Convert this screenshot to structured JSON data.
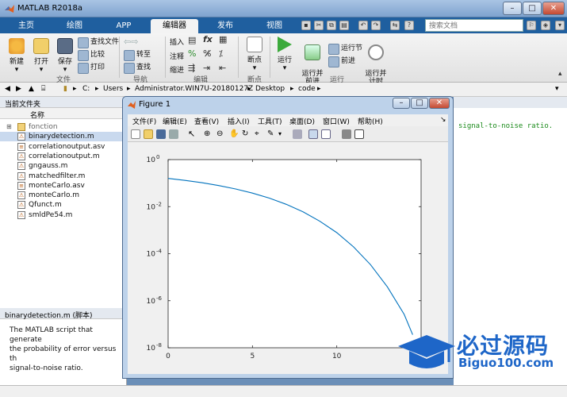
{
  "window": {
    "title": "MATLAB R2018a"
  },
  "ribbon_tabs": [
    "主页",
    "绘图",
    "APP",
    "编辑器",
    "发布",
    "视图"
  ],
  "search": {
    "placeholder": "搜索文档"
  },
  "ribbon": {
    "file": {
      "new": "新建",
      "open": "打开",
      "save": "保存",
      "find_files": "查找文件",
      "compare": "比较",
      "print": "打印",
      "group": "文件"
    },
    "nav": {
      "goto": "转至",
      "find": "查找",
      "group": "导航"
    },
    "edit": {
      "insert": "插入",
      "comment": "注释",
      "indent": "缩进",
      "fx": "fx",
      "group": "编辑"
    },
    "breakpoints": {
      "label": "断点",
      "group": "断点"
    },
    "run": {
      "run": "运行",
      "run_advance": "运行并\n前进",
      "run_section": "运行节",
      "advance": "前进",
      "run_time": "运行并\n计时",
      "group": "运行"
    }
  },
  "address": {
    "segments": [
      "C:",
      "Users",
      "Administrator.WIN7U-20180127Z",
      "Desktop",
      "code"
    ]
  },
  "file_browser": {
    "header": "当前文件夹",
    "column": "名称",
    "items": [
      {
        "name": "fonction",
        "type": "folder"
      },
      {
        "name": "binarydetection.m",
        "type": "m",
        "selected": true
      },
      {
        "name": "correlationoutput.asv",
        "type": "asv"
      },
      {
        "name": "correlationoutput.m",
        "type": "m"
      },
      {
        "name": "gngauss.m",
        "type": "m"
      },
      {
        "name": "matchedfilter.m",
        "type": "m"
      },
      {
        "name": "monteCarlo.asv",
        "type": "asv"
      },
      {
        "name": "monteCarlo.m",
        "type": "m"
      },
      {
        "name": "Qfunct.m",
        "type": "m"
      },
      {
        "name": "smldPe54.m",
        "type": "m"
      }
    ]
  },
  "details": {
    "header": "binarydetection.m  (脚本)",
    "description_lines": [
      "The MATLAB script that generate",
      "the probability of error versus th",
      "signal-to-noise ratio."
    ]
  },
  "command_snippet": "signal-to-noise ratio.",
  "figure": {
    "title": "Figure 1",
    "menu": [
      "文件(F)",
      "编辑(E)",
      "查看(V)",
      "插入(I)",
      "工具(T)",
      "桌面(D)",
      "窗口(W)",
      "帮助(H)"
    ]
  },
  "chart_data": {
    "type": "line",
    "title": "",
    "xlabel": "",
    "ylabel": "",
    "xlim": [
      0,
      15
    ],
    "ylim": [
      1e-08,
      1
    ],
    "yscale": "log",
    "xticks": [
      0,
      5,
      10
    ],
    "yticks": [
      1,
      0.01,
      0.0001,
      1e-06,
      1e-08
    ],
    "ytick_labels": [
      {
        "b": "10",
        "e": "0"
      },
      {
        "b": "10",
        "e": "-2"
      },
      {
        "b": "10",
        "e": "-4"
      },
      {
        "b": "10",
        "e": "-6"
      },
      {
        "b": "10",
        "e": "-8"
      }
    ],
    "series": [
      {
        "color": "#0072bd",
        "x": [
          0,
          1,
          2,
          3,
          4,
          5,
          6,
          7,
          8,
          9,
          10,
          11,
          12,
          13,
          14,
          14.5
        ],
        "y": [
          0.159,
          0.13,
          0.104,
          0.0786,
          0.0565,
          0.0377,
          0.023,
          0.0126,
          0.006,
          0.00239,
          0.000783,
          0.000194,
          3.43e-05,
          3.87e-06,
          2.61e-07,
          3.57e-08
        ]
      }
    ]
  },
  "watermark": {
    "line1": "必过源码",
    "line2": "Biguo100.com"
  }
}
